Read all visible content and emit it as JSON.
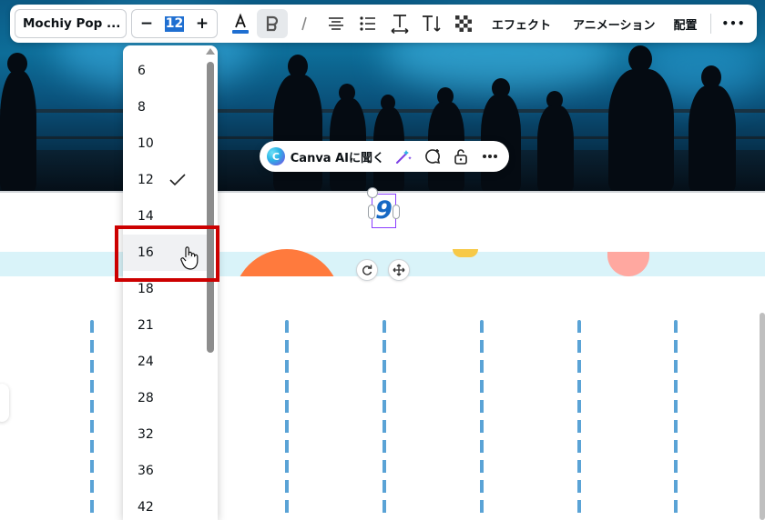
{
  "toolbar": {
    "font_name": "Mochiy Pop ...",
    "font_size": "12",
    "decrease_label": "−",
    "increase_label": "+",
    "text_color": "#1f6fd1",
    "effects_label": "エフェクト",
    "animation_label": "アニメーション",
    "arrange_label": "配置",
    "more_label": "•••",
    "icons": [
      "text-color-icon",
      "bold-icon",
      "italic-icon",
      "align-center-icon",
      "bullet-list-icon",
      "letter-spacing-icon",
      "vertical-text-icon",
      "transparency-icon"
    ]
  },
  "ai_pill": {
    "label": "Canva AIに聞く",
    "icons": [
      "canva-ai-logo-icon",
      "magic-edit-icon",
      "comment-add-icon",
      "unlock-icon",
      "more-icon"
    ]
  },
  "selected_element": {
    "glyph": "9",
    "color": "#1668c4"
  },
  "font_size_dropdown": {
    "options": [
      "6",
      "8",
      "10",
      "12",
      "14",
      "16",
      "18",
      "21",
      "24",
      "28",
      "32",
      "36",
      "42"
    ],
    "selected": "12",
    "hovered": "16"
  },
  "colors": {
    "accent_purple": "#8b3dff",
    "highlight_red": "#cc0000",
    "band_blue": "#d9f3f9",
    "dash_blue": "#5aa3d6",
    "orange": "#ff7a3d",
    "pink": "#ffa8a0"
  }
}
